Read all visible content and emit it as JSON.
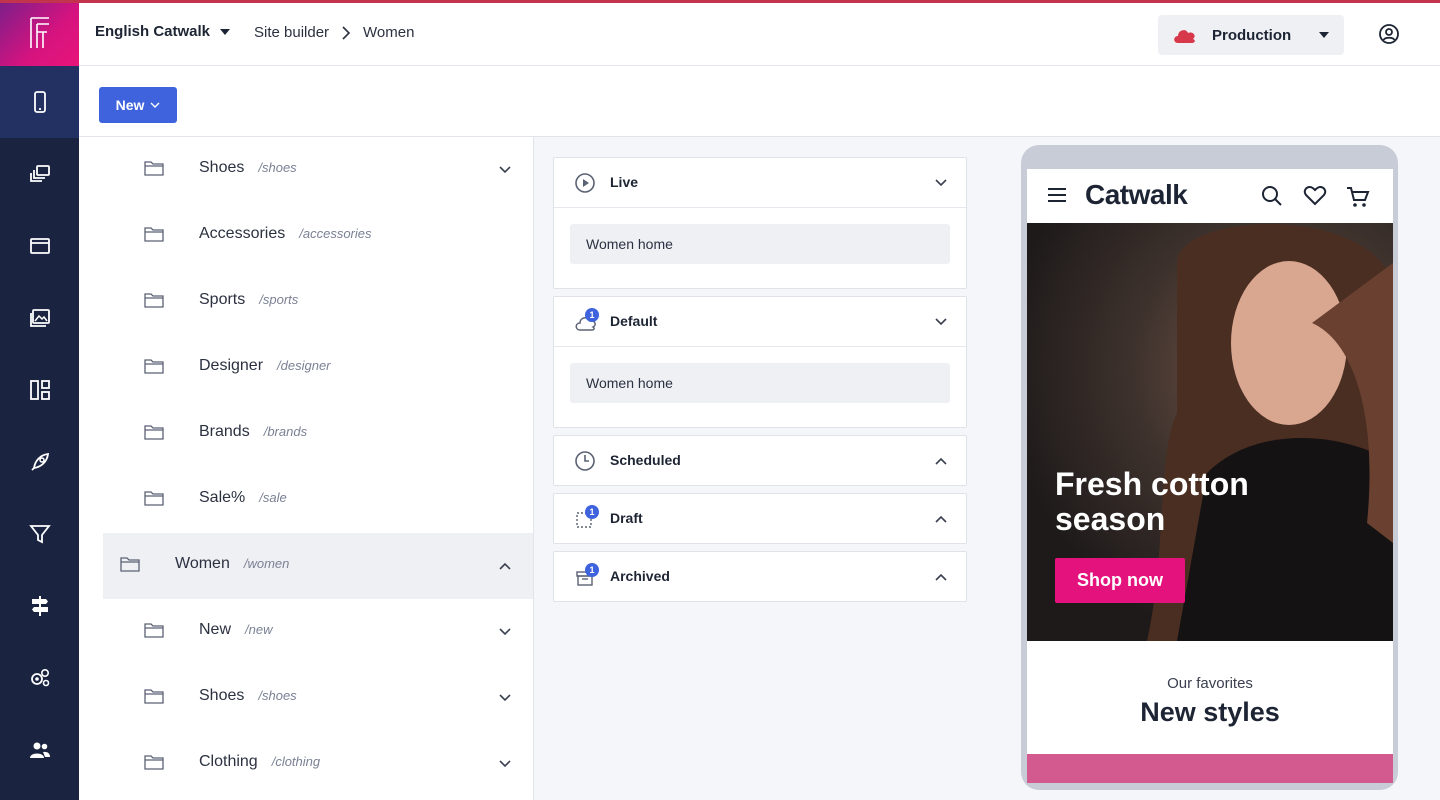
{
  "header": {
    "site": "English Catwalk",
    "breadcrumb": [
      "Site builder",
      "Women"
    ],
    "environment": "Production"
  },
  "toolbar": {
    "new_label": "New"
  },
  "rail": {
    "items": [
      "phone-icon",
      "pages-icon",
      "window-icon",
      "media-icon",
      "layout-icon",
      "rocket-icon",
      "filter-icon",
      "signpost-icon",
      "settings-icon",
      "users-icon"
    ],
    "active": 0
  },
  "tree": {
    "nodes": [
      {
        "label": "Shoes",
        "path": "/shoes",
        "level": 2,
        "expanded": false
      },
      {
        "label": "Accessories",
        "path": "/accessories",
        "level": 2,
        "expanded": null
      },
      {
        "label": "Sports",
        "path": "/sports",
        "level": 2,
        "expanded": null
      },
      {
        "label": "Designer",
        "path": "/designer",
        "level": 2,
        "expanded": null
      },
      {
        "label": "Brands",
        "path": "/brands",
        "level": 2,
        "expanded": null
      },
      {
        "label": "Sale%",
        "path": "/sale",
        "level": 2,
        "expanded": null
      },
      {
        "label": "Women",
        "path": "/women",
        "level": 1,
        "expanded": true,
        "selected": true
      },
      {
        "label": "New",
        "path": "/new",
        "level": 2,
        "expanded": false
      },
      {
        "label": "Shoes",
        "path": "/shoes",
        "level": 2,
        "expanded": false
      },
      {
        "label": "Clothing",
        "path": "/clothing",
        "level": 2,
        "expanded": false
      }
    ]
  },
  "panels": [
    {
      "title": "Live",
      "icon": "play-icon",
      "badge": null,
      "open": true,
      "items": [
        "Women home"
      ]
    },
    {
      "title": "Default",
      "icon": "cloud-icon",
      "badge": "1",
      "open": true,
      "items": [
        "Women home"
      ]
    },
    {
      "title": "Scheduled",
      "icon": "clock-icon",
      "badge": null,
      "open": false,
      "items": []
    },
    {
      "title": "Draft",
      "icon": "draft-icon",
      "badge": "1",
      "open": false,
      "items": []
    },
    {
      "title": "Archived",
      "icon": "archive-icon",
      "badge": "1",
      "open": false,
      "items": []
    }
  ],
  "preview": {
    "brand": "Catwalk",
    "hero_title_1": "Fresh cotton",
    "hero_title_2": "season",
    "cta": "Shop now",
    "section_sub": "Our favorites",
    "section_title": "New styles"
  },
  "colors": {
    "rail": "#1a2340",
    "accent": "#3e63dd",
    "brand_pink": "#e4127c",
    "cloud_red": "#d8394a"
  }
}
